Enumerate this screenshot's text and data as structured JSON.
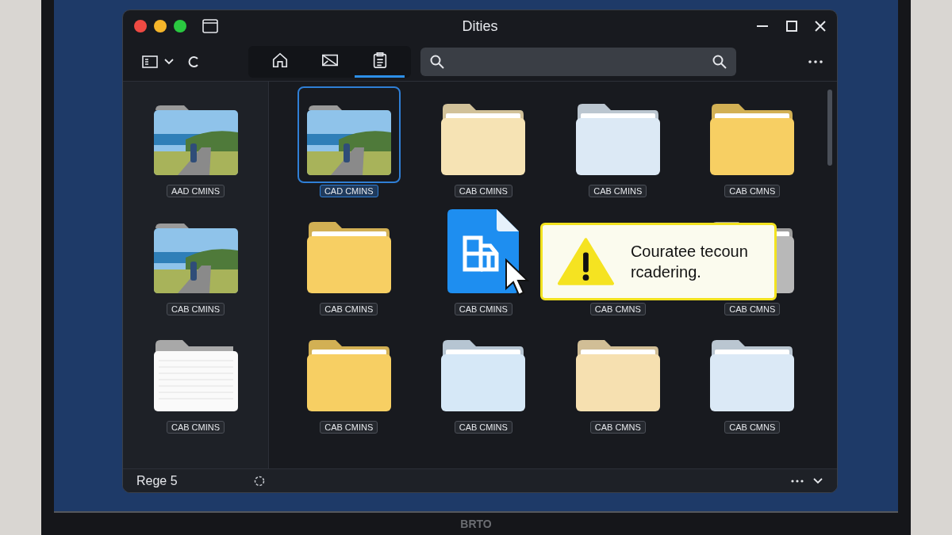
{
  "window": {
    "title": "Dities"
  },
  "nav_tabs": [
    {
      "kind": "home",
      "selected": false
    },
    {
      "kind": "mail",
      "selected": false
    },
    {
      "kind": "clipboard",
      "selected": true
    }
  ],
  "sidebar": {
    "items": [
      {
        "kind": "photo",
        "label": "AAD CMINS",
        "selected": false
      },
      {
        "kind": "photo",
        "label": "CAB CMINS",
        "selected": false
      },
      {
        "kind": "document",
        "label": "CAB CMINS",
        "selected": false
      }
    ]
  },
  "grid": {
    "items": [
      {
        "kind": "photo",
        "label": "CAD CMINS",
        "selected": true
      },
      {
        "kind": "folder",
        "color": "#f6e3b4",
        "label": "CAB CMINS",
        "selected": false
      },
      {
        "kind": "folder",
        "color": "#dce9f5",
        "label": "CAB CMINS",
        "selected": false
      },
      {
        "kind": "folder",
        "color": "#f7cf63",
        "label": "CAB CMNS",
        "selected": false
      },
      {
        "kind": "folder",
        "color": "#f7cf63",
        "label": "CAB CMINS",
        "selected": false
      },
      {
        "kind": "spreadsheet",
        "label": "CAB CMINS",
        "selected": false
      },
      {
        "kind": "hidden",
        "label": "CAB CMNS",
        "selected": false
      },
      {
        "kind": "folder",
        "color": "#b8b8b8",
        "label": "CAB CMNS",
        "selected": false
      },
      {
        "kind": "folder",
        "color": "#f7cf63",
        "label": "CAB CMINS",
        "selected": false
      },
      {
        "kind": "folder",
        "color": "#d6e8f7",
        "label": "CAB CMINS",
        "selected": false
      },
      {
        "kind": "folder",
        "color": "#f6e0b0",
        "label": "CAB CMNS",
        "selected": false
      },
      {
        "kind": "folder",
        "color": "#dbe9f6",
        "label": "CAB CMNS",
        "selected": false
      }
    ]
  },
  "warning_tooltip": {
    "text": "Couratee tecoun rcadering."
  },
  "status_bar": {
    "text": "Rege 5"
  },
  "monitor": {
    "logo": "BRTO"
  }
}
